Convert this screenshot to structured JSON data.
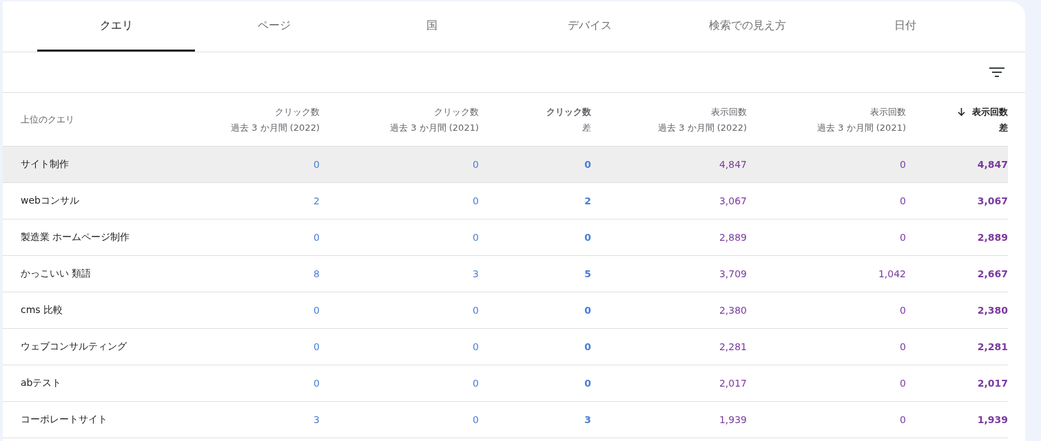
{
  "tabs": [
    {
      "label": "クエリ",
      "selected": true
    },
    {
      "label": "ページ",
      "selected": false
    },
    {
      "label": "国",
      "selected": false
    },
    {
      "label": "デバイス",
      "selected": false
    },
    {
      "label": "検索での見え方",
      "selected": false
    },
    {
      "label": "日付",
      "selected": false
    }
  ],
  "table": {
    "query_header": "上位のクエリ",
    "columns": [
      {
        "label": "クリック数",
        "sublabel": "過去 3 か月間 (2022)",
        "kind": "clicks",
        "diff": false,
        "sorted": false
      },
      {
        "label": "クリック数",
        "sublabel": "過去 3 か月間 (2021)",
        "kind": "clicks",
        "diff": false,
        "sorted": false
      },
      {
        "label": "クリック数",
        "sublabel": "差",
        "kind": "clicks",
        "diff": true,
        "sorted": false
      },
      {
        "label": "表示回数",
        "sublabel": "過去 3 か月間 (2022)",
        "kind": "impressions",
        "diff": false,
        "sorted": false
      },
      {
        "label": "表示回数",
        "sublabel": "過去 3 か月間 (2021)",
        "kind": "impressions",
        "diff": false,
        "sorted": false
      },
      {
        "label": "表示回数",
        "sublabel": "差",
        "kind": "impressions",
        "diff": true,
        "sorted": true
      }
    ],
    "rows": [
      {
        "query": "サイト制作",
        "hovered": true,
        "cells": [
          "0",
          "0",
          "0",
          "4,847",
          "0",
          "4,847"
        ]
      },
      {
        "query": "webコンサル",
        "hovered": false,
        "cells": [
          "2",
          "0",
          "2",
          "3,067",
          "0",
          "3,067"
        ]
      },
      {
        "query": "製造業 ホームページ制作",
        "hovered": false,
        "cells": [
          "0",
          "0",
          "0",
          "2,889",
          "0",
          "2,889"
        ]
      },
      {
        "query": "かっこいい 類語",
        "hovered": false,
        "cells": [
          "8",
          "3",
          "5",
          "3,709",
          "1,042",
          "2,667"
        ]
      },
      {
        "query": "cms 比較",
        "hovered": false,
        "cells": [
          "0",
          "0",
          "0",
          "2,380",
          "0",
          "2,380"
        ]
      },
      {
        "query": "ウェブコンサルティング",
        "hovered": false,
        "cells": [
          "0",
          "0",
          "0",
          "2,281",
          "0",
          "2,281"
        ]
      },
      {
        "query": "abテスト",
        "hovered": false,
        "cells": [
          "0",
          "0",
          "0",
          "2,017",
          "0",
          "2,017"
        ]
      },
      {
        "query": "コーポレートサイト",
        "hovered": false,
        "cells": [
          "3",
          "0",
          "3",
          "1,939",
          "0",
          "1,939"
        ]
      }
    ]
  }
}
